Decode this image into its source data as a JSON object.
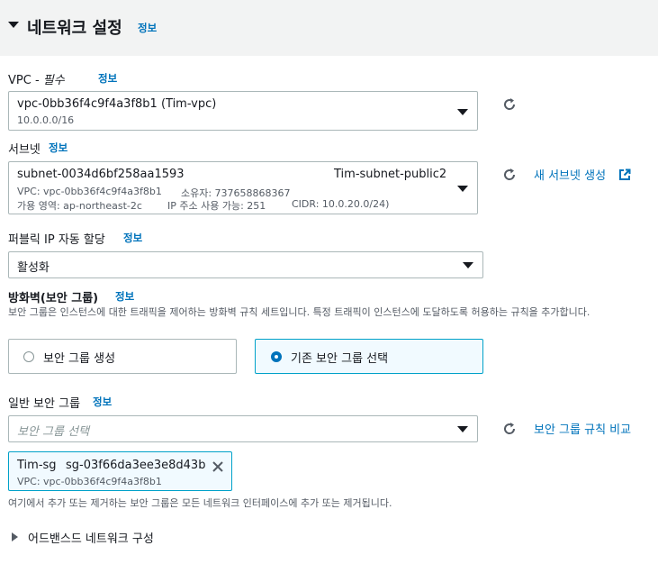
{
  "section": {
    "title": "네트워크 설정",
    "info": "정보"
  },
  "vpc": {
    "label": "VPC - ",
    "required": "필수",
    "info": "정보",
    "selected_id": "vpc-0bb36f4c9f4a3f8b1 (Tim-vpc)",
    "selected_cidr": "10.0.0.0/16"
  },
  "subnet": {
    "label": "서브넷",
    "info": "정보",
    "selected_id": "subnet-0034d6bf258aa1593",
    "selected_name": "Tim-subnet-public2",
    "detail_vpc": "VPC: vpc-0bb36f4c9f4a3f8b1",
    "detail_owner": "소유자: 737658868367",
    "detail_az": "가용 영역: ap-northeast-2c",
    "detail_ip": "IP 주소 사용 가능: 251",
    "detail_cidr": "CIDR: 10.0.20.0/24)",
    "create_link": "새 서브넷 생성"
  },
  "public_ip": {
    "label": "퍼블릭 IP 자동 할당",
    "info": "정보",
    "value": "활성화"
  },
  "firewall": {
    "label": "방화벽(보안 그룹)",
    "info": "정보",
    "description": "보안 그룹은 인스턴스에 대한 트래픽을 제어하는 방화벽 규칙 세트입니다. 특정 트래픽이 인스턴스에 도달하도록 허용하는 규칙을 추가합니다.",
    "option_create": "보안 그룹 생성",
    "option_existing": "기존 보안 그룹 선택",
    "selected_option": "existing"
  },
  "common_sg": {
    "label": "일반 보안 그룹",
    "info": "정보",
    "placeholder": "보안 그룹 선택",
    "compare_link": "보안 그룹 규칙 비교",
    "token_name": "Tim-sg",
    "token_id": "sg-03f66da3ee3e8d43b",
    "token_vpc": "VPC: vpc-0bb36f4c9f4a3f8b1",
    "hint": "여기에서 추가 또는 제거하는 보안 그룹은 모든 네트워크 인터페이스에 추가 또는 제거됩니다."
  },
  "advanced": {
    "label": "어드밴스드 네트워크 구성"
  },
  "colors": {
    "link": "#0073bb",
    "selected_border": "#00a1c9",
    "selected_bg": "#f1faff",
    "header_bg": "#f2f3f3"
  }
}
